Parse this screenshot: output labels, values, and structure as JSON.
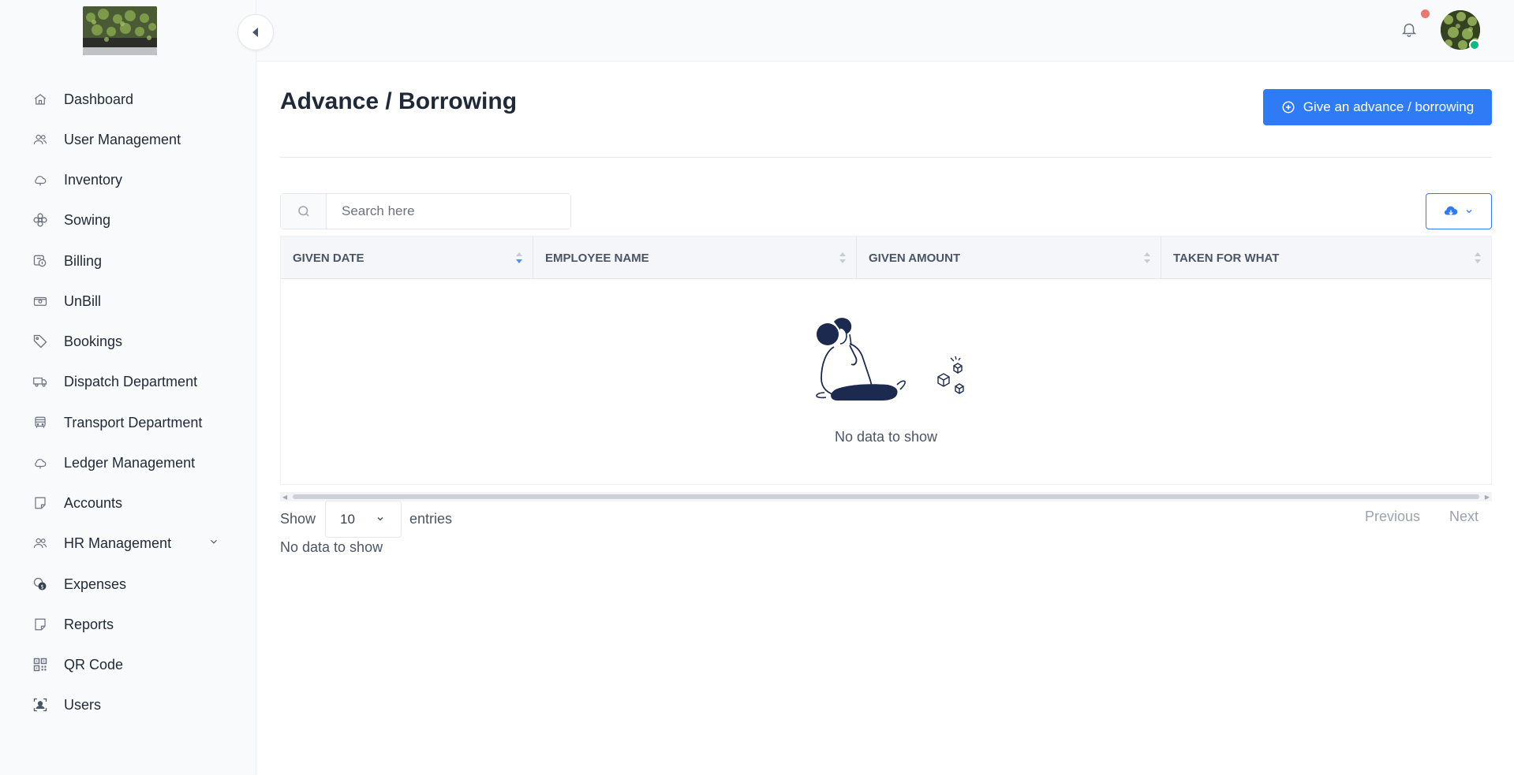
{
  "sidebar": {
    "items": [
      {
        "label": "Dashboard",
        "icon": "home-icon"
      },
      {
        "label": "User Management",
        "icon": "users-icon"
      },
      {
        "label": "Inventory",
        "icon": "cloud-icon"
      },
      {
        "label": "Sowing",
        "icon": "flower-icon"
      },
      {
        "label": "Billing",
        "icon": "bill-icon"
      },
      {
        "label": "UnBill",
        "icon": "cash-icon"
      },
      {
        "label": "Bookings",
        "icon": "tag-icon"
      },
      {
        "label": "Dispatch Department",
        "icon": "truck-icon"
      },
      {
        "label": "Transport Department",
        "icon": "bus-icon"
      },
      {
        "label": "Ledger Management",
        "icon": "cloud-icon"
      },
      {
        "label": "Accounts",
        "icon": "note-icon"
      },
      {
        "label": "HR Management",
        "icon": "users-icon",
        "has_submenu": true
      },
      {
        "label": "Expenses",
        "icon": "coins-icon"
      },
      {
        "label": "Reports",
        "icon": "note-icon"
      },
      {
        "label": "QR Code",
        "icon": "qr-code-icon"
      },
      {
        "label": "Users",
        "icon": "user-badge-icon"
      }
    ]
  },
  "main": {
    "title": "Advance / Borrowing",
    "primary_action": "Give an advance / borrowing",
    "search": {
      "placeholder": "Search here",
      "value": ""
    },
    "table": {
      "columns": [
        "GIVEN DATE",
        "EMPLOYEE NAME",
        "GIVEN AMOUNT",
        "TAKEN FOR WHAT"
      ],
      "sorted_column": "GIVEN DATE",
      "sort_direction": "desc",
      "rows": [],
      "empty_message": "No data to show"
    },
    "pagination": {
      "show_label": "Show",
      "page_size": "10",
      "entries_label": "entries",
      "info": "No data to show",
      "previous": "Previous",
      "next": "Next"
    }
  },
  "colors": {
    "primary": "#2f7bf5",
    "notification_dot": "#e8786b",
    "online": "#10b981"
  }
}
